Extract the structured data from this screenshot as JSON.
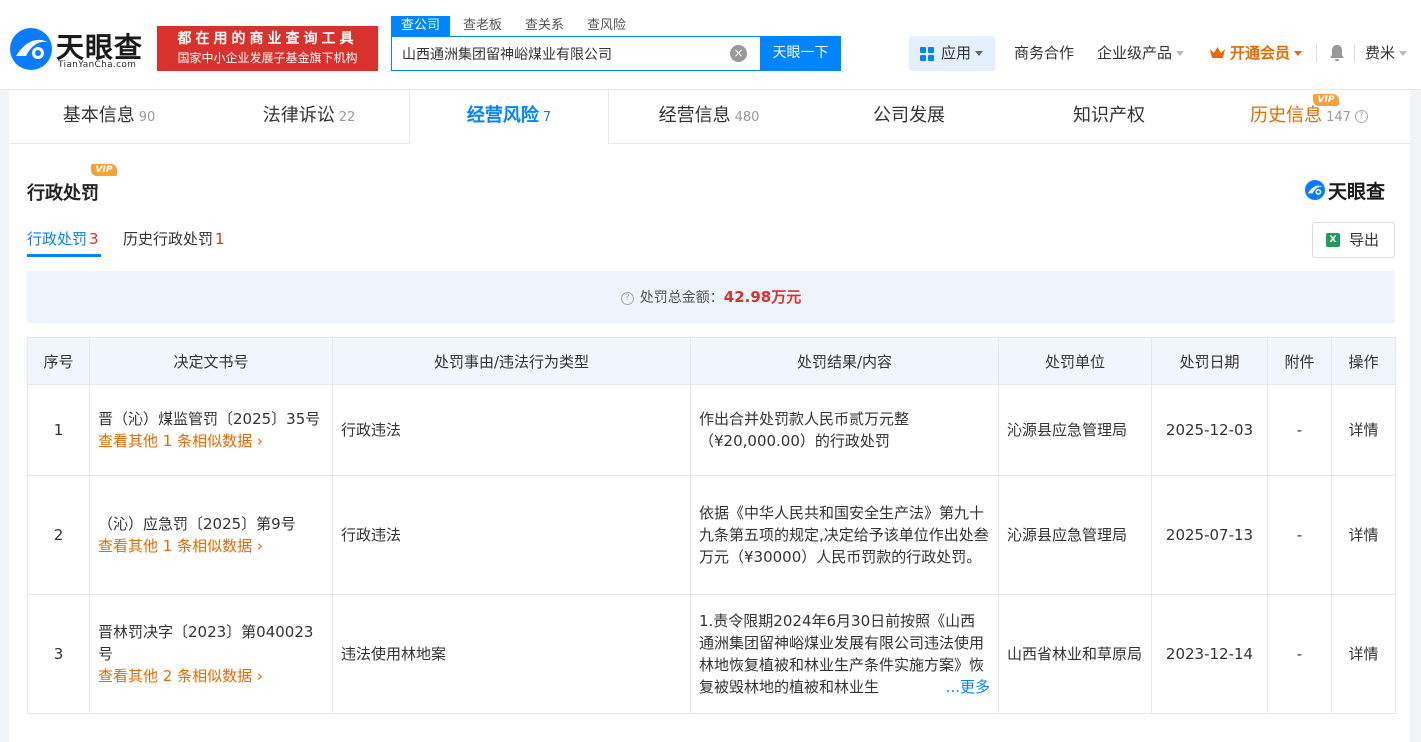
{
  "header": {
    "logo_cn": "天眼查",
    "logo_en": "TianYanCha.com",
    "slogan_line1": "都在用的商业查询工具",
    "slogan_line2": "国家中小企业发展子基金旗下机构",
    "search_tabs": [
      "查公司",
      "查老板",
      "查关系",
      "查风险"
    ],
    "search_value": "山西通洲集团留神峪煤业有限公司",
    "search_button": "天眼一下",
    "clear_icon": "×",
    "nav": {
      "app": "应用",
      "business": "商务合作",
      "enterprise": "企业级产品",
      "vip": "开通会员",
      "user": "费米"
    }
  },
  "main_tabs": [
    {
      "label": "基本信息",
      "count": "90"
    },
    {
      "label": "法律诉讼",
      "count": "22"
    },
    {
      "label": "经营风险",
      "count": "7"
    },
    {
      "label": "经营信息",
      "count": "480"
    },
    {
      "label": "公司发展",
      "count": ""
    },
    {
      "label": "知识产权",
      "count": ""
    },
    {
      "label": "历史信息",
      "count": "147"
    }
  ],
  "vip_tag": "VIP",
  "section": {
    "title": "行政处罚",
    "brand": "天眼查",
    "subtabs": [
      {
        "label": "行政处罚",
        "count": "3"
      },
      {
        "label": "历史行政处罚",
        "count": "1"
      }
    ],
    "export": "导出",
    "excel_icon": "X",
    "summary_label": "处罚总金额：",
    "summary_amount": "42.98万元"
  },
  "table": {
    "headers": [
      "序号",
      "决定文书号",
      "处罚事由/违法行为类型",
      "处罚结果/内容",
      "处罚单位",
      "处罚日期",
      "附件",
      "操作"
    ],
    "rows": [
      {
        "no": "1",
        "doc": "晋（沁）煤监管罚〔2025〕35号",
        "similar": "查看其他 1 条相似数据 ›",
        "reason": "行政违法",
        "result": "作出合并处罚款人民币贰万元整（¥20,000.00）的行政处罚",
        "more": "",
        "unit": "沁源县应急管理局",
        "date": "2025-12-03",
        "attach": "-",
        "action": "详情"
      },
      {
        "no": "2",
        "doc": "（沁）应急罚〔2025〕第9号",
        "similar": "查看其他 1 条相似数据 ›",
        "reason": "行政违法",
        "result": "依据《中华人民共和国安全生产法》第九十九条第五项的规定,决定给予该单位作出处叁万元（¥30000）人民币罚款的行政处罚。",
        "more": "",
        "unit": "沁源县应急管理局",
        "date": "2025-07-13",
        "attach": "-",
        "action": "详情"
      },
      {
        "no": "3",
        "doc": "晋林罚决字〔2023〕第040023号",
        "similar": "查看其他 2 条相似数据 ›",
        "reason": "违法使用林地案",
        "result": "1.责令限期2024年6月30日前按照《山西通洲集团留神峪煤业发展有限公司违法使用林地恢复植被和林业生产条件实施方案》恢复被毁林地的植被和林业生",
        "more": "...更多",
        "unit": "山西省林业和草原局",
        "date": "2023-12-14",
        "attach": "-",
        "action": "详情"
      }
    ]
  }
}
